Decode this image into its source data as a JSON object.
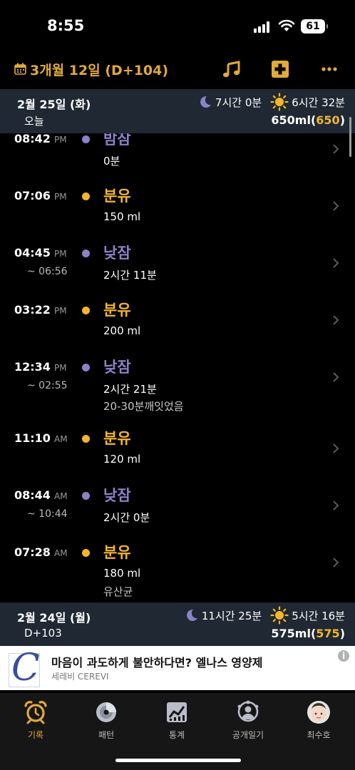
{
  "status_bar": {
    "time": "8:55",
    "battery": "61"
  },
  "header": {
    "title": "3개월 12일 (D+104)"
  },
  "days": [
    {
      "date": "2월 25일 (화)",
      "sub": "오늘",
      "night_sleep": "7시간 0분",
      "day_sleep": "6시간 32분",
      "ml": "650ml",
      "ml_goal": "650",
      "entries": [
        {
          "time": "08:42",
          "ampm": "PM",
          "type": "밤잠",
          "detail": "0분"
        },
        {
          "time": "07:06",
          "ampm": "PM",
          "type": "분유",
          "detail": "150 ml"
        },
        {
          "time": "04:45",
          "ampm": "PM",
          "end": "~ 06:56",
          "type": "낮잠",
          "detail": "2시간 11분"
        },
        {
          "time": "03:22",
          "ampm": "PM",
          "type": "분유",
          "detail": "200 ml"
        },
        {
          "time": "12:34",
          "ampm": "PM",
          "end": "~ 02:55",
          "type": "낮잠",
          "detail": "2시간 21분",
          "memo": "20-30분깨잇었음"
        },
        {
          "time": "11:10",
          "ampm": "AM",
          "type": "분유",
          "detail": "120 ml"
        },
        {
          "time": "08:44",
          "ampm": "AM",
          "end": "~ 10:44",
          "type": "낮잠",
          "detail": "2시간 0분"
        },
        {
          "time": "07:28",
          "ampm": "AM",
          "type": "분유",
          "detail": "180 ml",
          "memo": "유산균"
        }
      ]
    },
    {
      "date": "2월 24일 (월)",
      "sub": "D+103",
      "night_sleep": "11시간 25분",
      "day_sleep": "5시간 16분",
      "ml": "575ml",
      "ml_goal": "575"
    }
  ],
  "ad": {
    "title": "마음이 과도하게 불안하다면? 엘나스 영양제",
    "sponsor": "세레비 CEREVI",
    "logo_letter": "C",
    "info": "i"
  },
  "tabs": [
    {
      "label": "기록",
      "icon": "alarm-clock-icon",
      "active": true
    },
    {
      "label": "패턴",
      "icon": "pattern-icon"
    },
    {
      "label": "통계",
      "icon": "statistics-icon"
    },
    {
      "label": "공개일기",
      "icon": "diary-icon"
    },
    {
      "label": "최수호",
      "icon": "baby-avatar-icon"
    }
  ],
  "colors": {
    "accent": "#e0a93b",
    "feed": "#f3b62b",
    "sleep": "#8b82c9",
    "day_header": "#1f2833",
    "background": "#000000"
  }
}
